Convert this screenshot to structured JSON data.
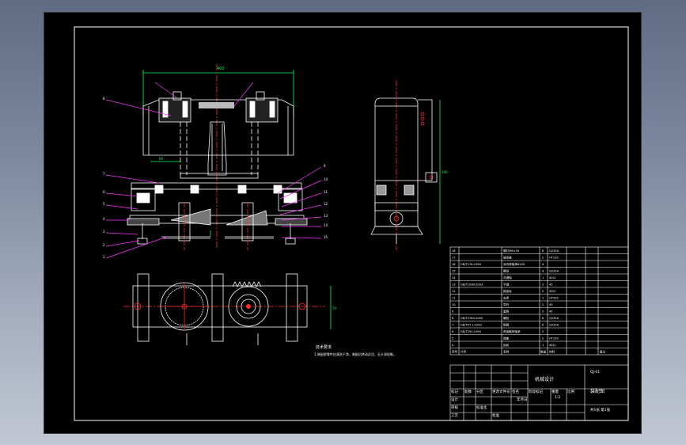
{
  "colors": {
    "background_gradient_top": "#5f6c84",
    "background_gradient_bottom": "#c1c7d3",
    "sheet": "#000000",
    "line_white": "#ffffff",
    "centerline_red": "#ff2a2a",
    "dimension_green": "#00ff55",
    "leader_magenta": "#ff33ff",
    "section_hatch": "#ffffff"
  },
  "icons": {
    "bolt_marker": "small-red-circle-icon"
  },
  "front_view": {
    "top_dimension": "400",
    "side_dimension": "60",
    "leader_labels_left": [
      "8",
      "7",
      "6",
      "5",
      "4",
      "3",
      "2",
      "1"
    ],
    "leader_labels_right": [
      "9",
      "10",
      "11",
      "12",
      "13",
      "14",
      "15"
    ]
  },
  "side_view": {
    "dimension": "190"
  },
  "plan_view": {
    "dimension": "70"
  },
  "notes": {
    "heading": "技术要求",
    "line1": "1.装配前零件应清洗干净，装配后转动灵活，无卡滞现象。"
  },
  "parts_list": {
    "rows": [
      {
        "no": "18",
        "code": "",
        "name": "螺钉M6×16",
        "qty": "8",
        "material": "Q235A"
      },
      {
        "no": "17",
        "code": "",
        "name": "轴承盖",
        "qty": "2",
        "material": "HT150"
      },
      {
        "no": "16",
        "code": "GB/T276-1994",
        "name": "深沟球轴承6205",
        "qty": "4",
        "material": ""
      },
      {
        "no": "15",
        "code": "",
        "name": "螺母",
        "qty": "4",
        "material": "Q235A"
      },
      {
        "no": "14",
        "code": "",
        "name": "花键轴",
        "qty": "1",
        "material": "40Cr"
      },
      {
        "no": "13",
        "code": "GB/T1096-2003",
        "name": "平键",
        "qty": "2",
        "material": "45"
      },
      {
        "no": "12",
        "code": "",
        "name": "锥齿轮",
        "qty": "2",
        "material": "40Cr"
      },
      {
        "no": "11",
        "code": "",
        "name": "支架",
        "qty": "1",
        "material": "HT200"
      },
      {
        "no": "10",
        "code": "",
        "name": "导杆",
        "qty": "2",
        "material": "45"
      },
      {
        "no": "9",
        "code": "",
        "name": "套筒",
        "qty": "2",
        "material": "45"
      },
      {
        "no": "8",
        "code": "GB/T5783-2000",
        "name": "螺栓",
        "qty": "6",
        "material": "Q235A"
      },
      {
        "no": "7",
        "code": "GB/T97.1-2002",
        "name": "垫圈",
        "qty": "6",
        "material": "Q235A"
      },
      {
        "no": "6",
        "code": "GB/T292-1994",
        "name": "角接触球轴承",
        "qty": "2",
        "material": ""
      },
      {
        "no": "5",
        "code": "",
        "name": "端盖",
        "qty": "2",
        "material": "HT150"
      },
      {
        "no": "4",
        "code": "",
        "name": "齿轮",
        "qty": "1",
        "material": "40Cr"
      }
    ],
    "header": {
      "no": "序号",
      "code": "代号",
      "name": "名称",
      "qty": "数量",
      "material": "材料",
      "mass": "备注"
    }
  },
  "title_block": {
    "drawing_title": "装配图",
    "company": "机械设计",
    "sheet_code": "QJ-01",
    "scale": "1:2",
    "sheet_info": "共1张 第1张",
    "mark_labels": [
      "标记",
      "处数",
      "分区",
      "更改文件号",
      "签名",
      "年月日"
    ],
    "role_labels": [
      "设计",
      "审核",
      "工艺",
      "批准"
    ],
    "stage_labels": [
      "阶段标记",
      "重量",
      "比例"
    ],
    "standardization": "标准化"
  }
}
